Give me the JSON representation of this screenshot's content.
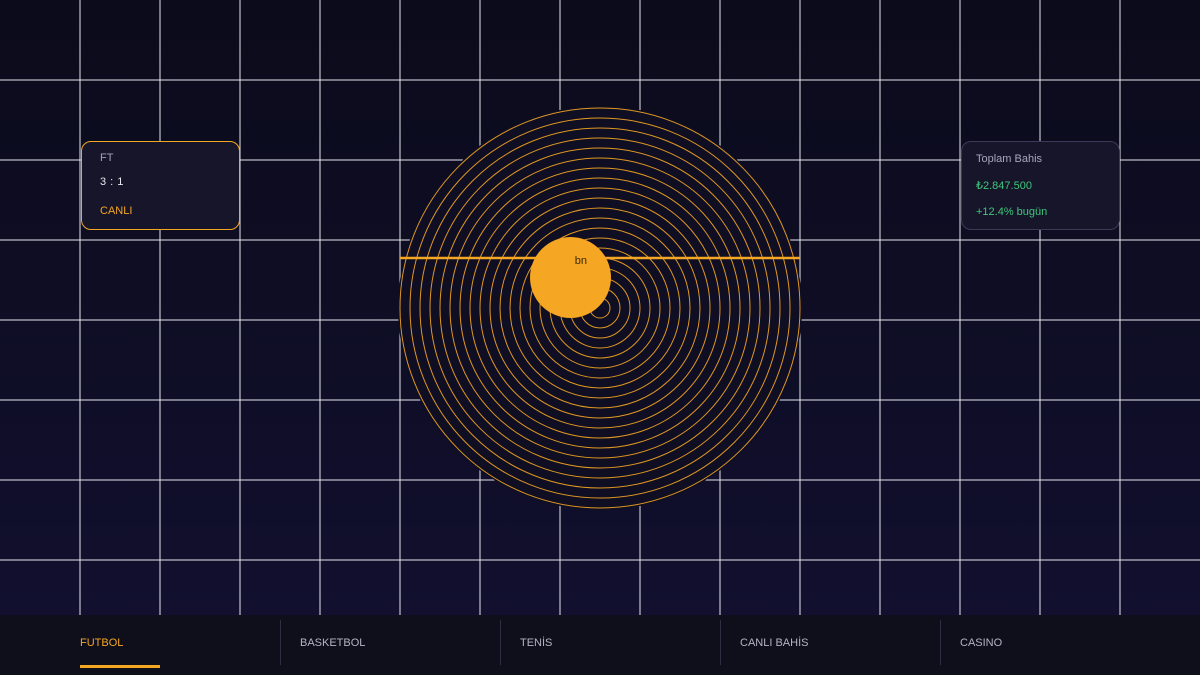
{
  "score_card": {
    "period": "FT",
    "score": "3 : 1",
    "status": "CANLI"
  },
  "ball": {
    "label": "bn"
  },
  "bets_card": {
    "label": "Toplam Bahis",
    "amount": "₺2.847.500",
    "change": "+12.4% bugün"
  },
  "tabs": [
    {
      "label": "FUTBOL",
      "active": true
    },
    {
      "label": "BASKETBOL",
      "active": false
    },
    {
      "label": "TENİS",
      "active": false
    },
    {
      "label": "CANLI BAHİS",
      "active": false
    },
    {
      "label": "CASINO",
      "active": false
    }
  ],
  "colors": {
    "accent": "#f5a623",
    "positive": "#3ec77a",
    "background": "#0e0d1f",
    "grid_line": "#e6e6ee"
  }
}
